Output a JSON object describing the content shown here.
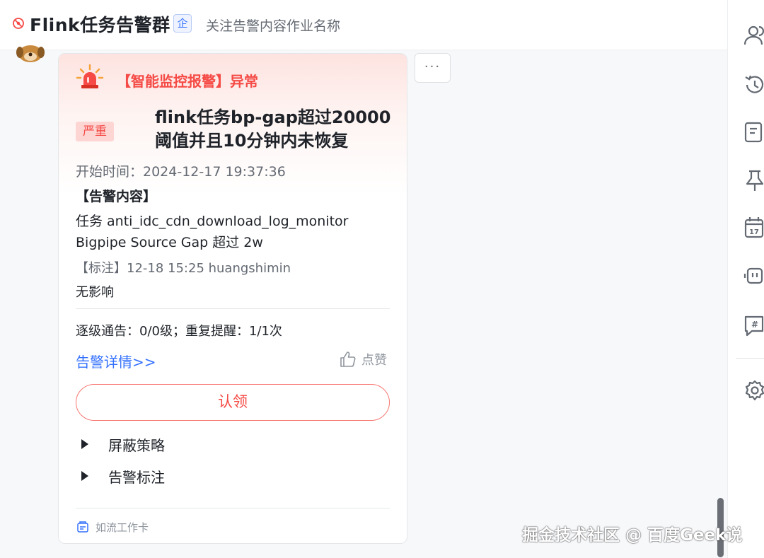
{
  "header": {
    "title": "Flink任务告警群",
    "badge": "企",
    "description": "关注告警内容作业名称"
  },
  "card": {
    "title": "【智能监控报警】异常",
    "severity": "严重",
    "headline": "flink任务bp-gap超过20000阈值并且10分钟内未恢复",
    "start_time": "开始时间：2024-12-17 19:37:36",
    "content_heading": "【告警内容】",
    "content_line1": "任务 anti_idc_cdn_download_log_monitor",
    "content_line2": "Bigpipe Source Gap 超过 2w",
    "annotation": "【标注】12-18 15:25 huangshimin",
    "impact": "无影响",
    "escalation": "逐级通告：0/0级；重复提醒：1/1次",
    "detail_link": "告警详情>>",
    "like_label": "点赞",
    "claim_button": "认领",
    "collapsibles": [
      "屏蔽策略",
      "告警标注"
    ],
    "footer": "如流工作卡"
  },
  "more_button": "···",
  "watermark": "掘金技术社区 @ 百度Geek说",
  "sidebar_icons": [
    "members-icon",
    "history-icon",
    "docs-icon",
    "pin-icon",
    "calendar-icon",
    "bot-icon",
    "topic-icon",
    "settings-icon"
  ],
  "calendar_day": "17",
  "colors": {
    "alert_red": "#f54a45",
    "link_blue": "#3370ff",
    "text_gray": "#646a73"
  }
}
